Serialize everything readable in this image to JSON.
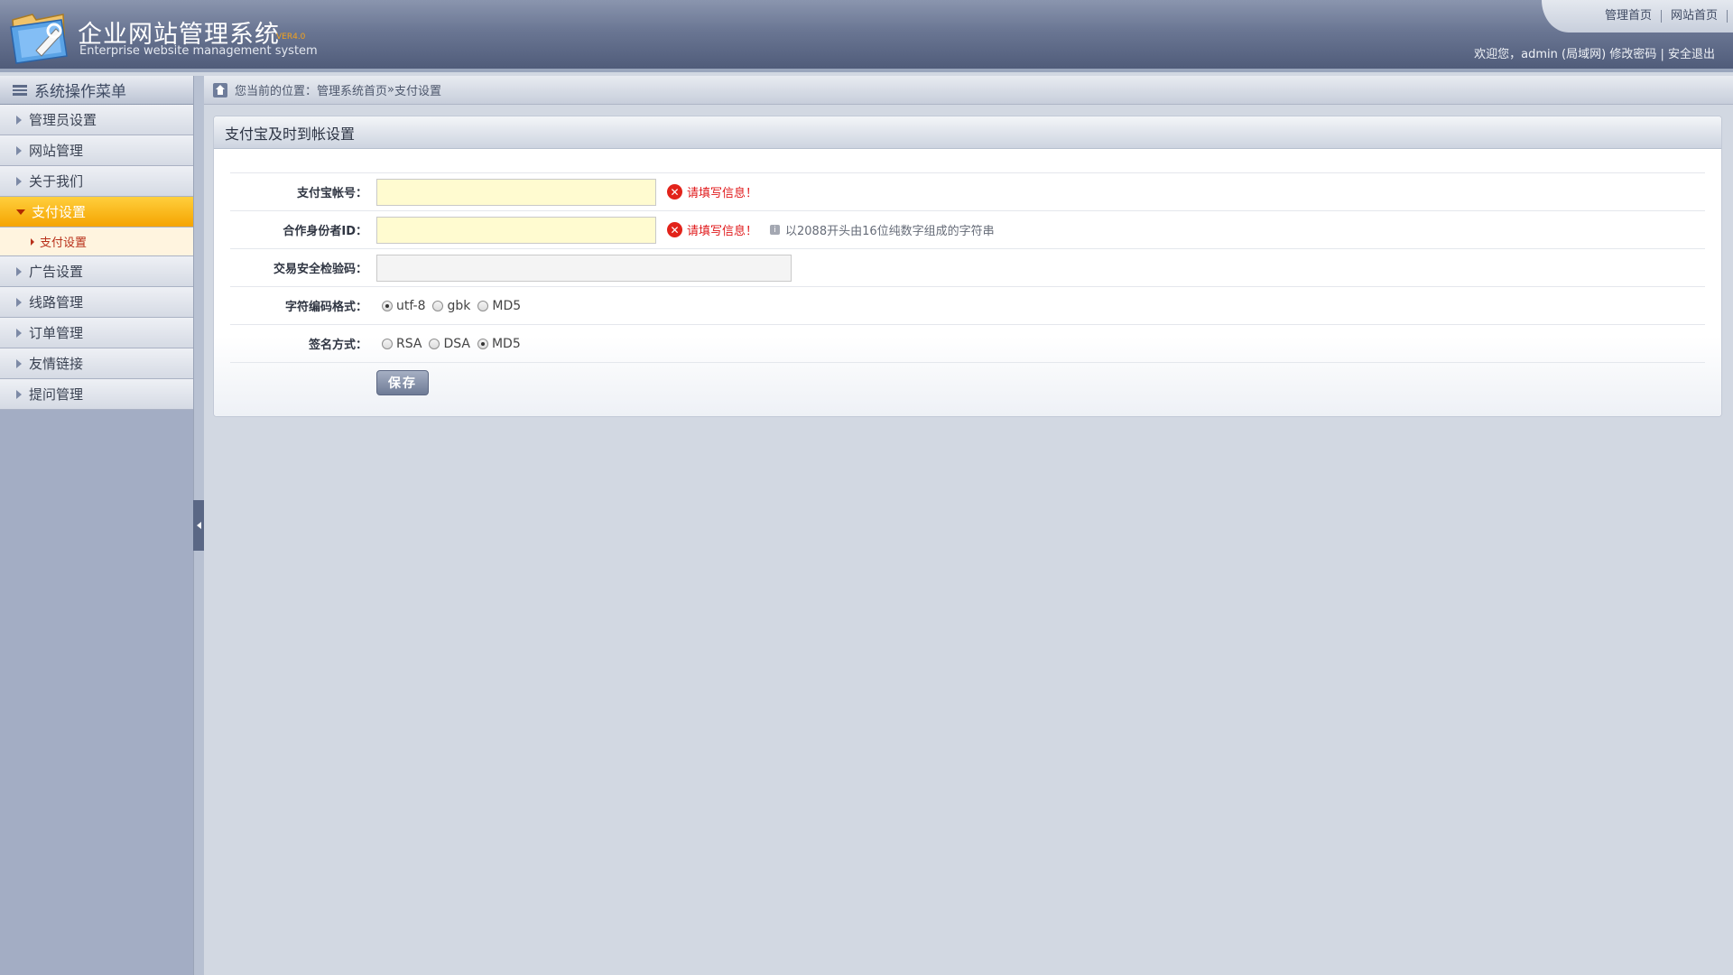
{
  "header": {
    "title": "企业网站管理系统",
    "version": "VER4.0",
    "subtitle": "Enterprise website management system",
    "top_links": [
      "管理首页",
      "网站首页"
    ],
    "welcome_prefix": "欢迎您，admin (局域网)",
    "change_password": "修改密码",
    "separator": " | ",
    "logout": "安全退出"
  },
  "sidebar": {
    "title": "系统操作菜单",
    "items": [
      {
        "label": "管理员设置"
      },
      {
        "label": "网站管理"
      },
      {
        "label": "关于我们"
      },
      {
        "label": "支付设置"
      },
      {
        "label": "广告设置"
      },
      {
        "label": "线路管理"
      },
      {
        "label": "订单管理"
      },
      {
        "label": "友情链接"
      },
      {
        "label": "提问管理"
      }
    ],
    "active_sub": "支付设置"
  },
  "breadcrumb": {
    "prefix": "您当前的位置：",
    "home": "管理系统首页",
    "sep": " » ",
    "current": "支付设置"
  },
  "panel": {
    "title": "支付宝及时到帐设置",
    "fields": {
      "account_label": "支付宝帐号：",
      "account_value": "",
      "account_error": "请填写信息！",
      "partner_label": "合作身份者ID：",
      "partner_value": "",
      "partner_error": "请填写信息！",
      "partner_hint": "以2088开头由16位纯数字组成的字符串",
      "key_label": "交易安全检验码：",
      "key_value": "",
      "charset_label": "字符编码格式：",
      "charset_options": [
        "utf-8",
        "gbk",
        "MD5"
      ],
      "charset_selected": "utf-8",
      "sign_label": "签名方式：",
      "sign_options": [
        "RSA",
        "DSA",
        "MD5"
      ],
      "sign_selected": "MD5"
    },
    "save_label": "保存"
  },
  "colors": {
    "header_bg": "#6a7693",
    "active_menu": "#f5a400",
    "input_highlight": "#fffbd0",
    "error": "#e0191b"
  }
}
